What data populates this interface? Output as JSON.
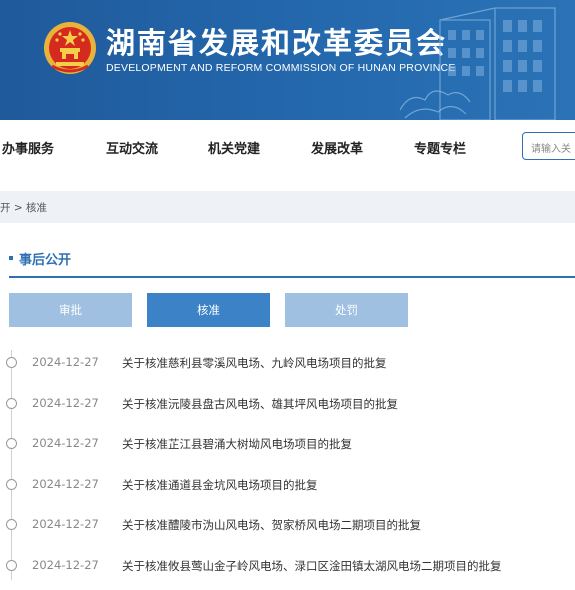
{
  "header": {
    "title": "湖南省发展和改革委员会",
    "subtitle": "DEVELOPMENT AND REFORM COMMISSION OF HUNAN PROVINCE",
    "emblem_icon": "national-emblem-icon"
  },
  "nav": {
    "items": [
      {
        "label": "办事服务"
      },
      {
        "label": "互动交流"
      },
      {
        "label": "机关党建"
      },
      {
        "label": "发展改革"
      },
      {
        "label": "专题专栏"
      }
    ],
    "search_placeholder": "请输入关"
  },
  "breadcrumb": {
    "text": "开 > 核准"
  },
  "section": {
    "title": "事后公开"
  },
  "tabs": [
    {
      "label": "审批",
      "active": false
    },
    {
      "label": "核准",
      "active": true
    },
    {
      "label": "处罚",
      "active": false
    }
  ],
  "list": [
    {
      "date": "2024-12-27",
      "title": "关于核准慈利县零溪风电场、九岭风电场项目的批复"
    },
    {
      "date": "2024-12-27",
      "title": "关于核准沅陵县盘古风电场、雄其坪风电场项目的批复"
    },
    {
      "date": "2024-12-27",
      "title": "关于核准芷江县碧涌大树坳风电场项目的批复"
    },
    {
      "date": "2024-12-27",
      "title": "关于核准通道县金坑风电场项目的批复"
    },
    {
      "date": "2024-12-27",
      "title": "关于核准醴陵市沩山风电场、贺家桥风电场二期项目的批复"
    },
    {
      "date": "2024-12-27",
      "title": "关于核准攸县莺山金子岭风电场、渌口区淦田镇太湖风电场二期项目的批复"
    }
  ],
  "colors": {
    "header_blue": "#2468ad",
    "accent_blue": "#2f6fb3",
    "tab_active": "#3b82c6",
    "tab_inactive": "#9fc0e0"
  }
}
